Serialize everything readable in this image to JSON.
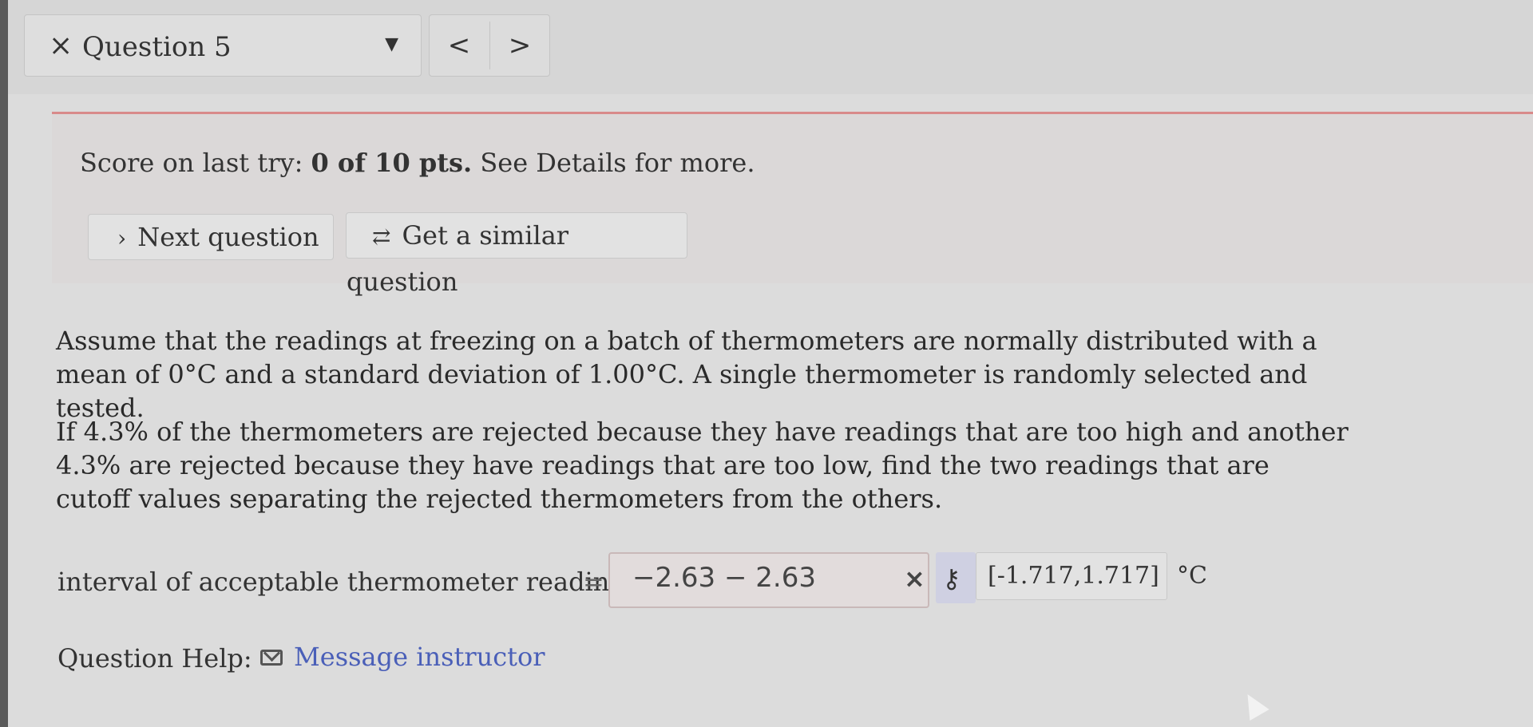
{
  "header": {
    "close_glyph": "×",
    "question_label": "Question 5",
    "dropdown_glyph": "▼",
    "prev_glyph": "<",
    "next_glyph": ">"
  },
  "score": {
    "prefix": "Score on last try: ",
    "value": "0 of 10 pts.",
    "suffix": " See Details for more."
  },
  "actions": {
    "next_icon": "›",
    "next_label": "Next question",
    "similar_icon": "⇄",
    "similar_label": "Get a similar question"
  },
  "question": {
    "paragraph1": "Assume that the readings at freezing on a batch of thermometers are normally distributed with a mean of 0°C and a standard deviation of 1.00°C. A single thermometer is randomly selected and tested.",
    "paragraph2": "If 4.3% of the thermometers are rejected because they have readings that are too high and another 4.3% are rejected because they have readings that are too low, find the two readings that are cutoff values separating the rejected thermometers from the others."
  },
  "answer": {
    "label": "interval of acceptable thermometer readings",
    "equals": "=",
    "value": "−2.63 − 2.63",
    "wrong_glyph": "×",
    "key_glyph": "⚷",
    "correct_answer": "[-1.717,1.717]",
    "unit": "°C"
  },
  "help": {
    "label": "Question Help:",
    "link": "Message instructor"
  },
  "colors": {
    "accent_line": "#d88a8a",
    "link": "#4a5fb8",
    "key_bg": "#cfd0e2"
  }
}
